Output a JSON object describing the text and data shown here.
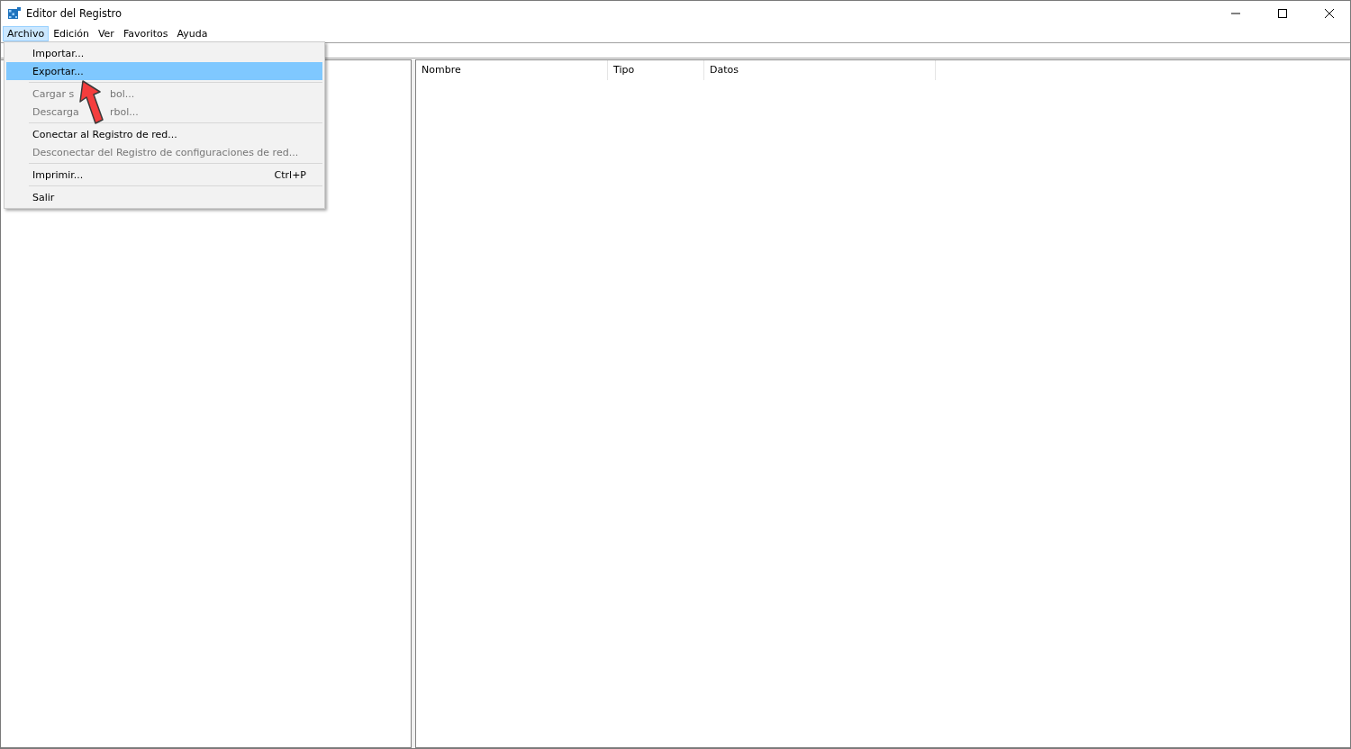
{
  "window": {
    "title": "Editor del Registro"
  },
  "menubar": [
    {
      "label": "Archivo",
      "selected": true
    },
    {
      "label": "Edición",
      "selected": false
    },
    {
      "label": "Ver",
      "selected": false
    },
    {
      "label": "Favoritos",
      "selected": false
    },
    {
      "label": "Ayuda",
      "selected": false
    }
  ],
  "menu": [
    {
      "kind": "item",
      "label": "Importar...",
      "selected": false,
      "disabled": false
    },
    {
      "kind": "item",
      "label": "Exportar...",
      "selected": true,
      "disabled": false
    },
    {
      "kind": "separator"
    },
    {
      "kind": "covered",
      "parts": [
        "Cargar s",
        "bol..."
      ],
      "selected": false,
      "disabled": true
    },
    {
      "kind": "covered",
      "parts": [
        "Descarga",
        "rbol..."
      ],
      "selected": false,
      "disabled": true
    },
    {
      "kind": "separator"
    },
    {
      "kind": "item",
      "label": "Conectar al Registro de red...",
      "selected": false,
      "disabled": false
    },
    {
      "kind": "item",
      "label": "Desconectar del Registro de configuraciones de red...",
      "selected": false,
      "disabled": true
    },
    {
      "kind": "separator"
    },
    {
      "kind": "item",
      "label": "Imprimir...",
      "shortcut": "Ctrl+P",
      "selected": false,
      "disabled": false
    },
    {
      "kind": "separator"
    },
    {
      "kind": "item",
      "label": "Salir",
      "selected": false,
      "disabled": false
    }
  ],
  "list": {
    "columns": [
      "Nombre",
      "Tipo",
      "Datos"
    ]
  }
}
